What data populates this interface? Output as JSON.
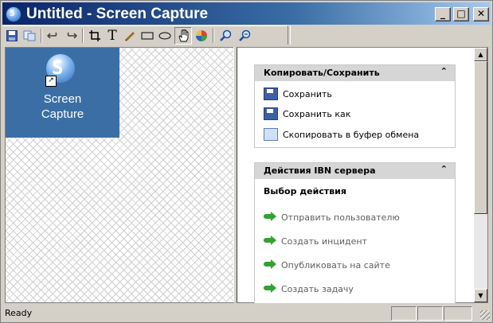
{
  "window": {
    "title": "Untitled - Screen Capture",
    "app_icon_letter": "S",
    "controls": {
      "minimize": "_",
      "maximize": "□",
      "close": "✕"
    }
  },
  "toolbar": {
    "tools": [
      {
        "name": "save",
        "icon": "save-icon"
      },
      {
        "name": "copy",
        "icon": "copy-icon"
      },
      {
        "name": "undo",
        "icon": "undo-icon"
      },
      {
        "name": "redo",
        "icon": "redo-icon"
      },
      {
        "name": "crop",
        "icon": "crop-icon"
      },
      {
        "name": "text",
        "icon": "text-icon",
        "glyph": "T"
      },
      {
        "name": "pen",
        "icon": "pen-icon"
      },
      {
        "name": "rectangle",
        "icon": "rectangle-icon"
      },
      {
        "name": "ellipse",
        "icon": "ellipse-icon"
      },
      {
        "name": "hand",
        "icon": "hand-icon"
      },
      {
        "name": "color",
        "icon": "color-wheel-icon"
      },
      {
        "name": "zoom-in",
        "icon": "zoom-in-icon"
      },
      {
        "name": "zoom-out",
        "icon": "zoom-out-icon"
      }
    ]
  },
  "canvas": {
    "desktop_icon": {
      "letter": "S",
      "label_line1": "Screen",
      "label_line2": "Capture"
    }
  },
  "panel": {
    "copy_save": {
      "title": "Копировать/Сохранить",
      "collapse_glyph": "⌃",
      "items": [
        {
          "label": "Сохранить"
        },
        {
          "label": "Сохранить как"
        },
        {
          "label": "Скопировать в буфер обмена"
        }
      ]
    },
    "ibn_actions": {
      "title": "Действия IBN сервера",
      "collapse_glyph": "⌃",
      "subtitle": "Выбор действия",
      "items": [
        {
          "label": "Отправить пользователю"
        },
        {
          "label": "Создать инцидент"
        },
        {
          "label": "Опубликовать на сайте"
        },
        {
          "label": "Создать задачу"
        }
      ]
    }
  },
  "status": {
    "text": "Ready"
  }
}
